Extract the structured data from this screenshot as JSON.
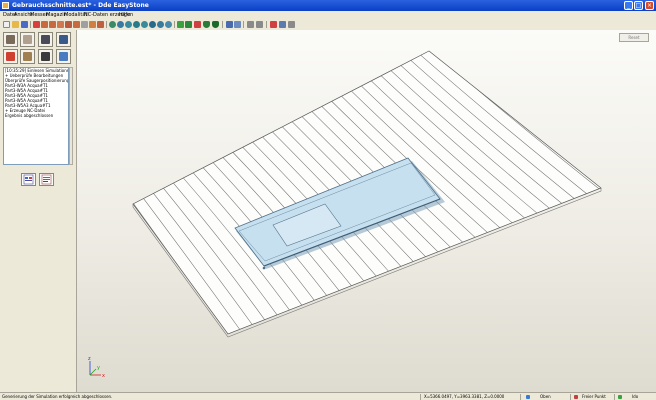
{
  "window": {
    "title": "Gebrauchsschnitte.est* - Dde EasyStone"
  },
  "menu": [
    "Datei",
    "Ansicht",
    "Messen",
    "Magazin",
    "Modalität",
    "NC-Daten erzeugen",
    "Hilfe"
  ],
  "log": [
    "[10:35:29] Einlesen Simulationsdaten",
    "+ Ueberprüfe Bearbeitungen",
    "  Überprüfe Saugerpositionierung",
    "  Part3-W3A Acqua#T1",
    "  Part3-W5A Acqua#T1",
    "  Part3-W5A Acqua#T1",
    "  Part3-W5A Acqua#T1",
    "  Part3-W5A3 Acqua#T1",
    "+ Erzeuge NC-Datei",
    "Ergebnis abgeschlossen"
  ],
  "viewport": {
    "reset_label": "Reset",
    "axes": {
      "x": "x",
      "y": "y",
      "z": "z"
    }
  },
  "status": {
    "message": "Generierung der Simulation erfolgreich abgeschlossen.",
    "coords": "X=5366.0497, Y=3963.3381, Z=0.0000",
    "view": "Oben",
    "point_mode": "Freier Punkt",
    "last": "Ido"
  },
  "colors": {
    "titlebar": "#0a3fc4",
    "slab_lines": "#6f6f6f",
    "glass": "#bfdcef"
  }
}
